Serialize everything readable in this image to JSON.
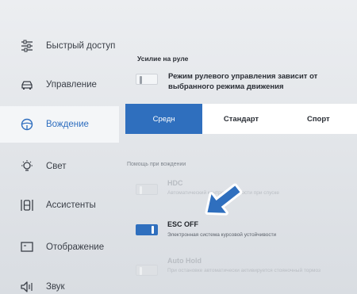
{
  "sidebar": {
    "items": [
      {
        "label": "Быстрый доступ",
        "icon": "sliders-icon",
        "active": false
      },
      {
        "label": "Управление",
        "icon": "car-icon",
        "active": false
      },
      {
        "label": "Вождение",
        "icon": "steering-wheel-icon",
        "active": true
      },
      {
        "label": "Свет",
        "icon": "light-bulb-icon",
        "active": false
      },
      {
        "label": "Ассистенты",
        "icon": "driver-assist-icon",
        "active": false
      },
      {
        "label": "Отображение",
        "icon": "display-icon",
        "active": false
      },
      {
        "label": "Звук",
        "icon": "speaker-icon",
        "active": false
      }
    ]
  },
  "steering": {
    "title": "Усилие на руле",
    "toggle_state": "off",
    "description": "Режим рулевого управления зависит от выбранного режима движения",
    "modes": [
      "Средн",
      "Стандарт",
      "Спорт"
    ],
    "selected_mode": "Средн"
  },
  "assist": {
    "title": "Помощь при вождении",
    "hdc": {
      "title": "HDC",
      "description": "Автоматический контроль скорости при спуске",
      "state": "disabled"
    },
    "esc": {
      "title": "ESC OFF",
      "description": "Электронная система курсовой устойчивости",
      "state": "on"
    },
    "autohold": {
      "title": "Auto Hold",
      "description": "При остановке автоматически активируется стояночный тормоз",
      "state": "disabled"
    }
  },
  "colors": {
    "accent": "#2f6fbe",
    "background": "#e3e6ea",
    "arrow": "#2f6fbe"
  }
}
